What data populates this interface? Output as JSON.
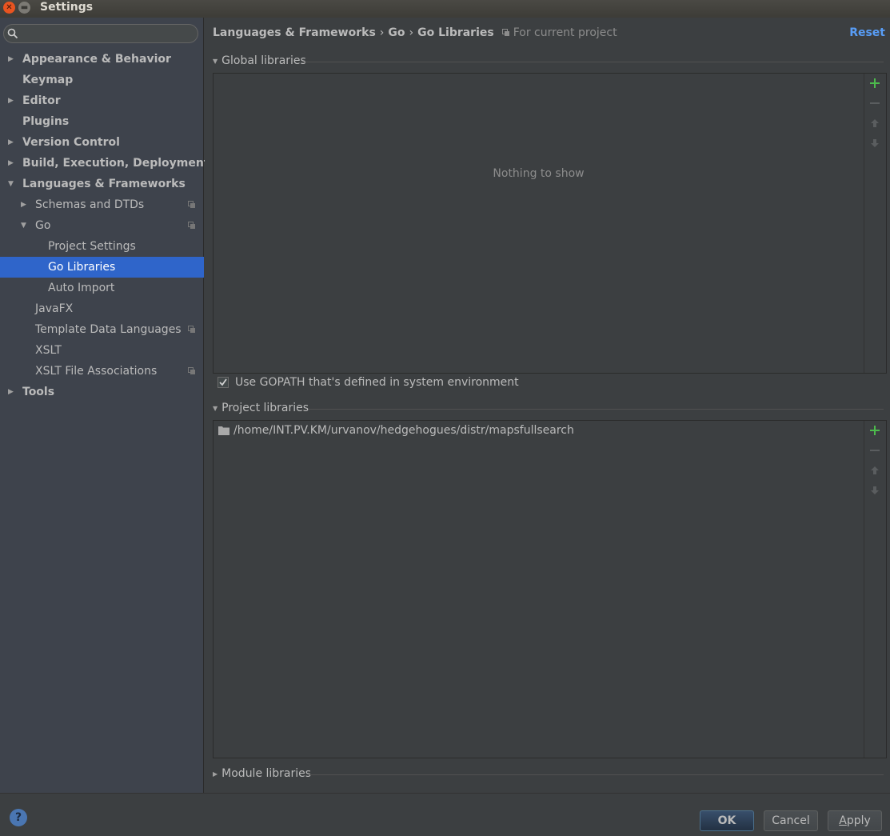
{
  "window": {
    "title": "Settings"
  },
  "search": {
    "placeholder": "",
    "value": ""
  },
  "sidebar": {
    "items": [
      {
        "label": "Appearance & Behavior",
        "level": 0,
        "arrow": "collapsed",
        "copy": false
      },
      {
        "label": "Keymap",
        "level": 0,
        "arrow": "none",
        "copy": false
      },
      {
        "label": "Editor",
        "level": 0,
        "arrow": "collapsed",
        "copy": false
      },
      {
        "label": "Plugins",
        "level": 0,
        "arrow": "none",
        "copy": false
      },
      {
        "label": "Version Control",
        "level": 0,
        "arrow": "collapsed",
        "copy": false
      },
      {
        "label": "Build, Execution, Deployment",
        "level": 0,
        "arrow": "collapsed",
        "copy": false
      },
      {
        "label": "Languages & Frameworks",
        "level": 0,
        "arrow": "expanded",
        "copy": false
      },
      {
        "label": "Schemas and DTDs",
        "level": 1,
        "arrow": "collapsed",
        "copy": true
      },
      {
        "label": "Go",
        "level": 1,
        "arrow": "expanded",
        "copy": true
      },
      {
        "label": "Project Settings",
        "level": 2,
        "arrow": "none",
        "copy": false
      },
      {
        "label": "Go Libraries",
        "level": 2,
        "arrow": "none",
        "copy": false,
        "selected": true
      },
      {
        "label": "Auto Import",
        "level": 2,
        "arrow": "none",
        "copy": false
      },
      {
        "label": "JavaFX",
        "level": 1,
        "arrow": "none",
        "copy": false
      },
      {
        "label": "Template Data Languages",
        "level": 1,
        "arrow": "none",
        "copy": true
      },
      {
        "label": "XSLT",
        "level": 1,
        "arrow": "none",
        "copy": false
      },
      {
        "label": "XSLT File Associations",
        "level": 1,
        "arrow": "none",
        "copy": true
      },
      {
        "label": "Tools",
        "level": 0,
        "arrow": "collapsed",
        "copy": false
      }
    ]
  },
  "header": {
    "crumb1": "Languages & Frameworks",
    "crumb2": "Go",
    "crumb3": "Go Libraries",
    "separator": "›",
    "scope": "For current project",
    "reset": "Reset"
  },
  "global_libraries": {
    "title": "Global libraries",
    "empty_text": "Nothing to show"
  },
  "gopath_checkbox": {
    "label": "Use GOPATH that's defined in system environment",
    "checked": true
  },
  "project_libraries": {
    "title": "Project libraries",
    "items": [
      "/home/INT.PV.KM/urvanov/hedgehogues/distr/mapsfullsearch"
    ]
  },
  "module_libraries": {
    "title": "Module libraries"
  },
  "footer": {
    "help": "?",
    "ok": "OK",
    "cancel": "Cancel",
    "apply_first": "A",
    "apply_rest": "pply"
  },
  "colors": {
    "accent": "#589df6",
    "selection": "#2f65ca",
    "add": "#4cba4c"
  }
}
